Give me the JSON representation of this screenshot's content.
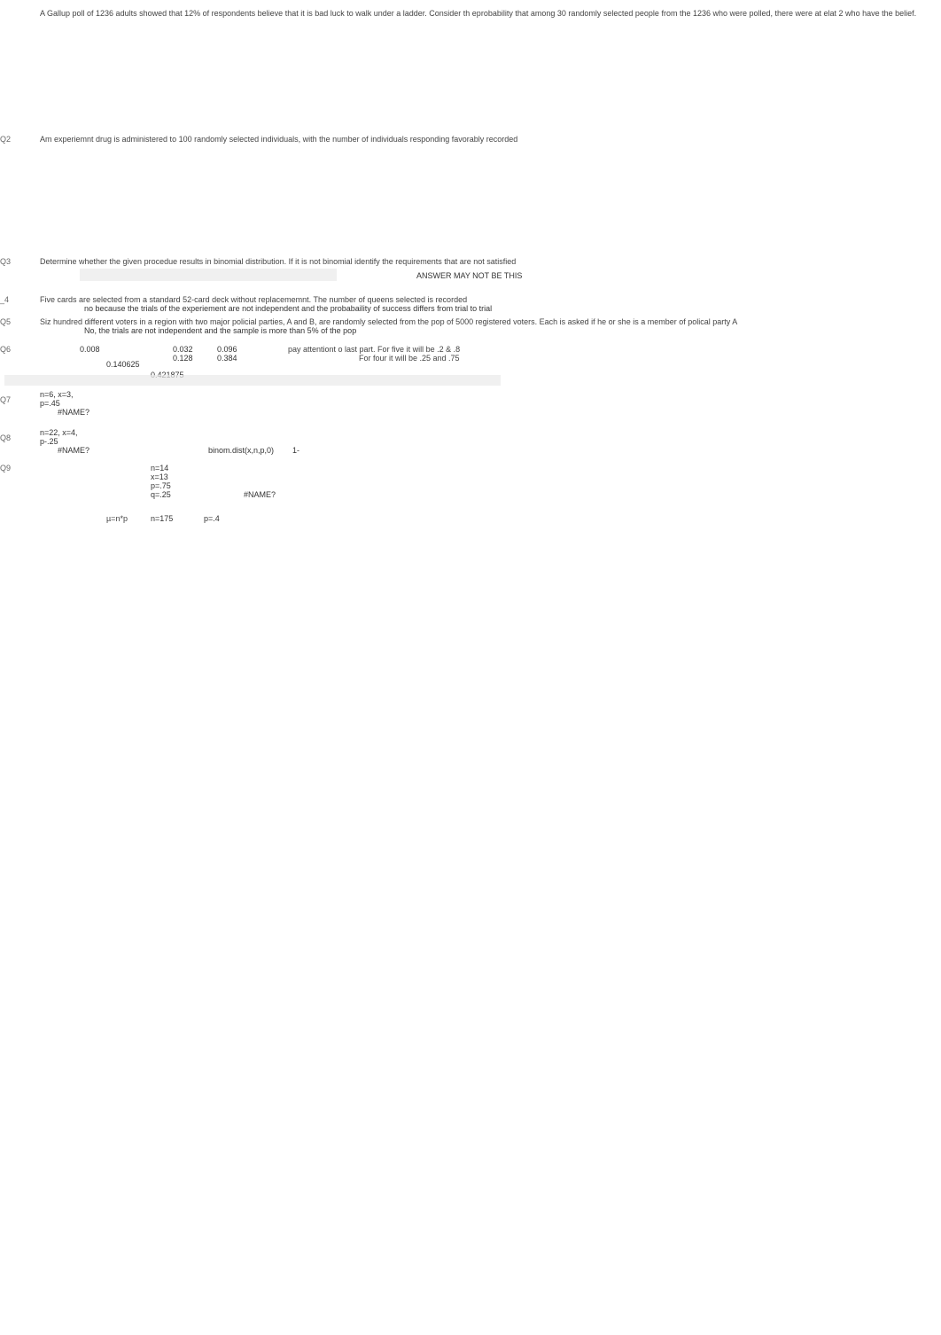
{
  "q1": {
    "text": "A Gallup poll of 1236 adults showed that 12% of respondents believe that it is bad luck to walk under a ladder. Consider th eprobability that among 30 randomly selected people from the 1236 who were polled, there were at elat 2 who have the belief."
  },
  "q2": {
    "label": "Q2",
    "text": "Am experiemnt drug is administered to 100 randomly selected individuals, with the number of individuals responding favorably recorded"
  },
  "q3": {
    "label": "Q3",
    "text": "Determine whether the given procedue results in binomial distribution. If it is not binomial identify the requirements that are not satisfied",
    "answer_note": "ANSWER MAY NOT BE THIS"
  },
  "q4": {
    "label": "_4",
    "text": "Five cards are selected from a standard 52-card deck without replacememnt. The number of queens selected is recorded",
    "sub": "no because the trials of the experiement are not independent and the probabaility of success differs from trial to trial"
  },
  "q5": {
    "label": "Q5",
    "text": "Siz hundred different voters in a region with two major policial parties, A and B, are randomly selected from the pop of 5000 registered voters. Each is asked if he or she is a member of polical party A",
    "sub": "No, the trials are not independent and the sample is more than 5% of the pop"
  },
  "q6": {
    "label": "Q6",
    "v1": "0.008",
    "v2": "0.032",
    "v3": "0.096",
    "note1": "pay attentiont o last part. For five it will be .2 & .8",
    "v4": "0.128",
    "v5": "0.384",
    "note2": "For four it will be .25 and .75",
    "v6": "0.140625",
    "v7": "0.421875"
  },
  "q7": {
    "label": "Q7",
    "params": "n=6, x=3, p=.45",
    "err": "#NAME?"
  },
  "q8": {
    "label": "Q8",
    "params": "n=22, x=4, p-.25",
    "err": "#NAME?",
    "formula": "binom.dist(x,n,p,0)",
    "tail": "1-"
  },
  "q9": {
    "label": "Q9",
    "n": "n=14",
    "x": "x=13",
    "p": "p=.75",
    "q": "q=.25",
    "err": "#NAME?",
    "mu_lbl": "µ=n*p",
    "mu_n": "n=175",
    "mu_p": "p=.4"
  }
}
